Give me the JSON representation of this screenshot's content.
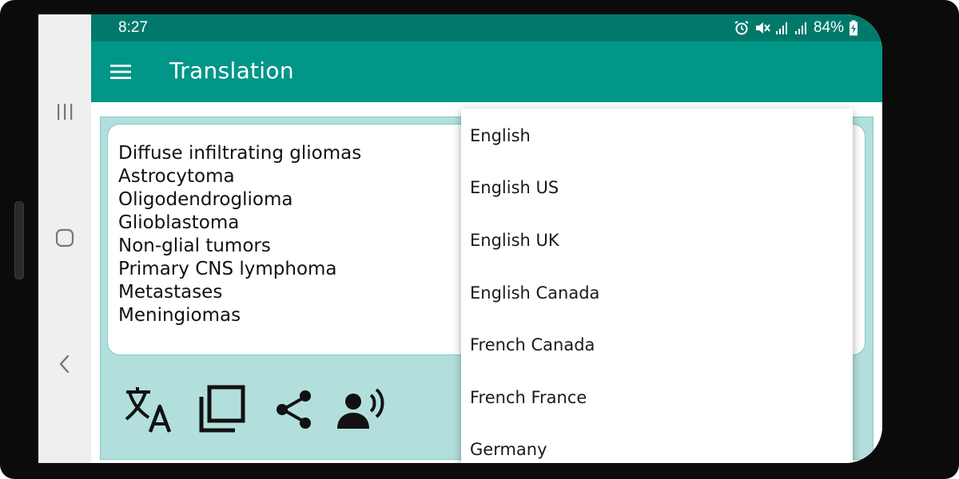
{
  "status_bar": {
    "time": "8:27",
    "battery": "84%",
    "icons": [
      "alarm-icon",
      "mute-icon",
      "signal-icon",
      "signal-icon",
      "battery-charging-icon"
    ]
  },
  "toolbar": {
    "title": "Translation",
    "menu_icon": "hamburger-menu-icon"
  },
  "system_nav": {
    "items": [
      "recents-icon",
      "home-icon",
      "back-icon"
    ]
  },
  "input": {
    "lines": [
      "Diffuse infiltrating gliomas",
      "Astrocytoma",
      "Oligodendroglioma",
      "Glioblastoma",
      "Non-glial tumors",
      "Primary CNS lymphoma",
      "Metastases",
      "Meningiomas"
    ]
  },
  "actions": {
    "icons": [
      "translate-icon",
      "copy-icon",
      "share-icon",
      "speak-icon"
    ]
  },
  "language_dropdown": {
    "options": [
      "English",
      "English US",
      "English UK",
      "English Canada",
      "French Canada",
      "French France",
      "Germany"
    ]
  },
  "colors": {
    "status_bar": "#00796b",
    "toolbar": "#009688",
    "panel": "#b2dfdb",
    "panel_border": "#80cbc4"
  }
}
